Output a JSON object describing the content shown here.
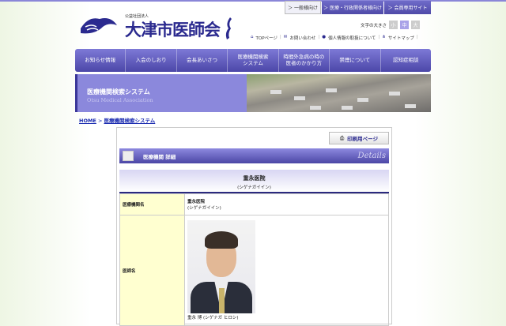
{
  "top_tabs": [
    {
      "label": "＞ 一般様向け",
      "active": true
    },
    {
      "label": "＞ 医療・行政関係者様向け",
      "active": false
    },
    {
      "label": "＞ 会員専用サイト",
      "active": false
    }
  ],
  "logo": {
    "small": "公益社団法人",
    "name": "大津市医師会"
  },
  "font_size": {
    "label": "文字の大きさ",
    "options": [
      "小",
      "中",
      "大"
    ]
  },
  "links": [
    "TOPページ",
    "お問い合わせ",
    "個人情報の取扱について",
    "サイトマップ"
  ],
  "nav": [
    "お知らせ情報",
    "入会のしおり",
    "会長あいさつ",
    "医療機関検索\nシステム",
    "時間外急病の時の\n医者のかかり方",
    "禁煙について",
    "認知症相談"
  ],
  "banner": {
    "title": "医療機関検索システム",
    "subtitle": "Otsu Medical Association"
  },
  "breadcrumb": {
    "home": "HOME",
    "sep": " > ",
    "current": "医療機関検索システム"
  },
  "print_label": "印刷用ページ",
  "section": {
    "title": "医療機関 詳細",
    "en": "Details"
  },
  "clinic": {
    "name": "重永医院",
    "kana": "(シゲナガイイン)"
  },
  "table": {
    "row1": {
      "label": "医療機関名",
      "name": "重永医院",
      "kana": "(シゲナガイイン)"
    },
    "row2": {
      "label": "医師名",
      "doctor": "重永 博 (シゲナガ ヒロシ)"
    }
  },
  "colors": {
    "accent": "#5a55b8",
    "label_bg": "#ffffd0"
  }
}
